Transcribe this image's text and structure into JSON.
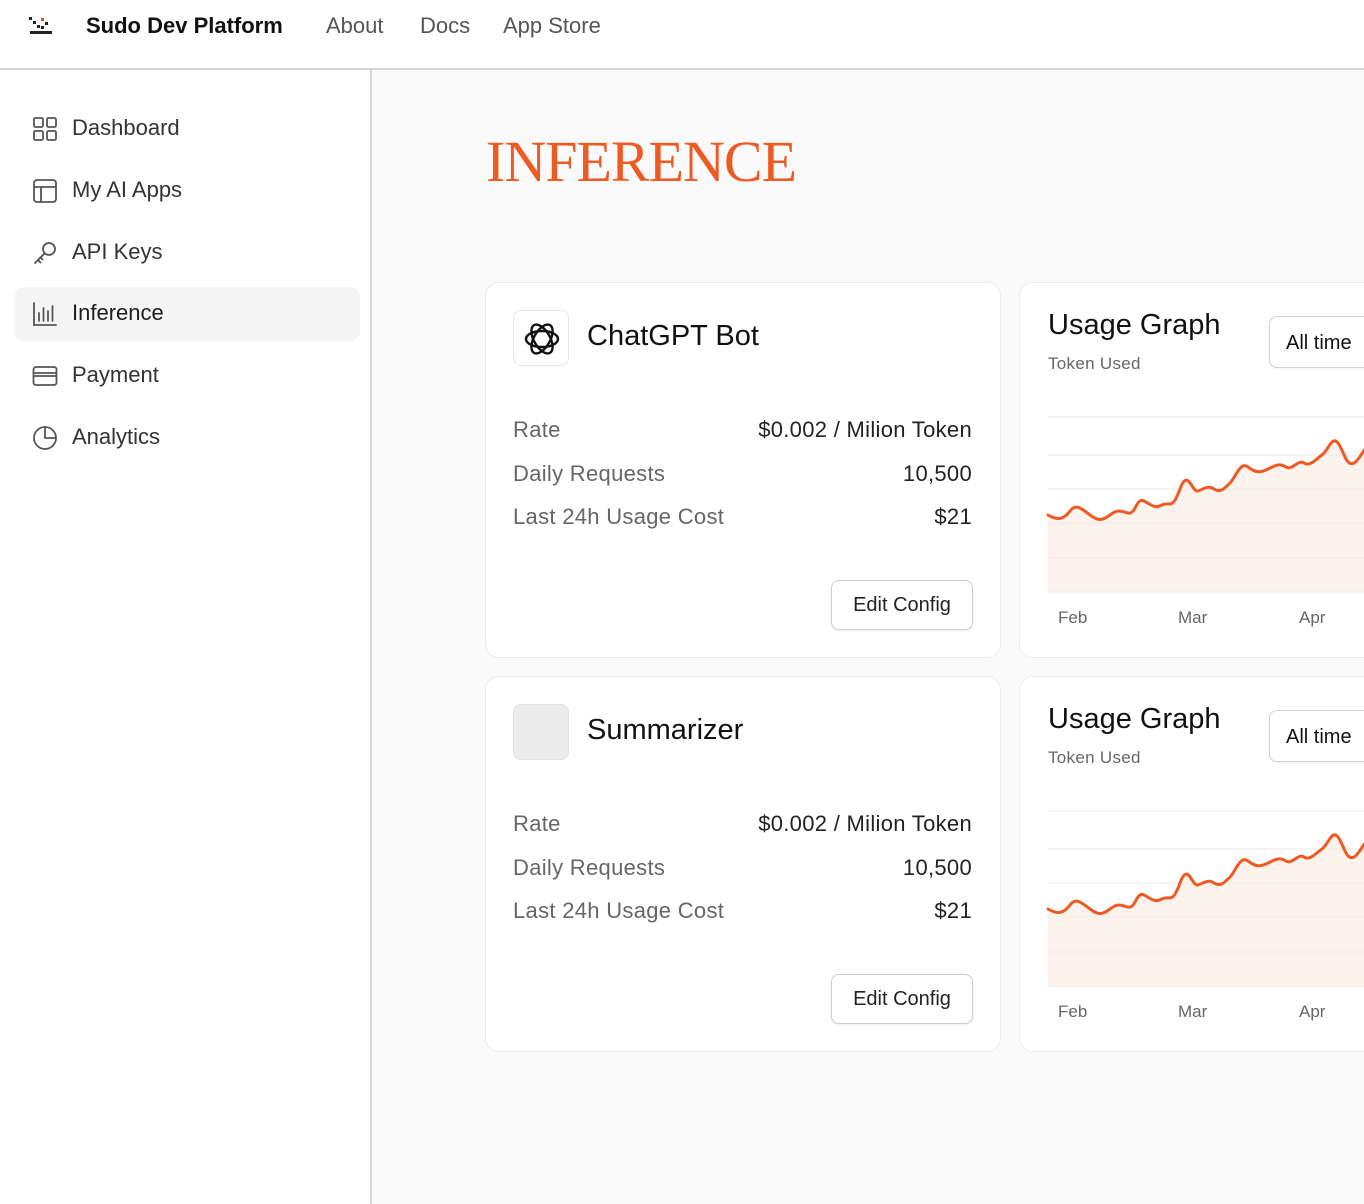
{
  "header": {
    "brand": "Sudo Dev Platform",
    "nav": [
      "About",
      "Docs",
      "App Store"
    ]
  },
  "sidebar": {
    "items": [
      {
        "label": "Dashboard",
        "icon": "grid-icon"
      },
      {
        "label": "My AI Apps",
        "icon": "layout-icon"
      },
      {
        "label": "API Keys",
        "icon": "key-icon"
      },
      {
        "label": "Inference",
        "icon": "bar-chart-icon",
        "active": true
      },
      {
        "label": "Payment",
        "icon": "credit-card-icon"
      },
      {
        "label": "Analytics",
        "icon": "pie-chart-icon"
      }
    ]
  },
  "page": {
    "title": "INFERENCE"
  },
  "accent_color": "#ee5a24",
  "apps": [
    {
      "name": "ChatGPT Bot",
      "icon": "openai-icon",
      "stats": [
        {
          "label": "Rate",
          "value": "$0.002 / Milion Token"
        },
        {
          "label": "Daily Requests",
          "value": "10,500"
        },
        {
          "label": "Last 24h Usage Cost",
          "value": "$21"
        }
      ],
      "edit_label": "Edit Config",
      "graph": {
        "title": "Usage Graph",
        "subtitle": "Token Used",
        "range": "All time",
        "months": [
          "Feb",
          "Mar",
          "Apr"
        ]
      }
    },
    {
      "name": "Summarizer",
      "icon": "blank-icon",
      "stats": [
        {
          "label": "Rate",
          "value": "$0.002 / Milion Token"
        },
        {
          "label": "Daily Requests",
          "value": "10,500"
        },
        {
          "label": "Last 24h Usage Cost",
          "value": "$21"
        }
      ],
      "edit_label": "Edit Config",
      "graph": {
        "title": "Usage Graph",
        "subtitle": "Token Used",
        "range": "All time",
        "months": [
          "Feb",
          "Mar",
          "Apr"
        ]
      }
    }
  ]
}
